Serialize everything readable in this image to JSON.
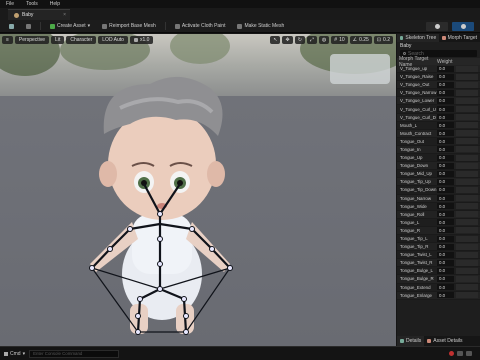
{
  "menu": {
    "items": [
      "File",
      "Tools",
      "Help"
    ]
  },
  "doc_tab": {
    "label": "Baby"
  },
  "toolbar": {
    "create_asset": "Create Asset",
    "reimport": "Reimport Base Mesh",
    "activate_cloth": "Activate Cloth Paint",
    "make_static": "Make Static Mesh"
  },
  "viewport": {
    "perspective": "Perspective",
    "lit": "Lit",
    "character": "Character",
    "lod": "LOD Auto",
    "speed": "x1.0",
    "stats": [
      "10",
      "0.25",
      "0.2"
    ]
  },
  "panel": {
    "tabs": [
      "Skeleton Tree",
      "Morph Target"
    ],
    "asset": "Baby",
    "search_placeholder": "Search",
    "col_name": "Morph Target Name",
    "col_weight": "Weight",
    "morphs": [
      {
        "name": "V_Tongue_up",
        "weight": "0.0"
      },
      {
        "name": "V_Tongue_Raise",
        "weight": "0.0"
      },
      {
        "name": "V_Tongue_Out",
        "weight": "0.0"
      },
      {
        "name": "V_Tongue_Narrow",
        "weight": "0.0"
      },
      {
        "name": "V_Tongue_Lower",
        "weight": "0.0"
      },
      {
        "name": "V_Tongue_Curl_U",
        "weight": "0.0"
      },
      {
        "name": "V_Tongue_Curl_D",
        "weight": "0.0"
      },
      {
        "name": "Mouth_L",
        "weight": "0.0"
      },
      {
        "name": "Mouth_Contract",
        "weight": "0.0"
      },
      {
        "name": "Tongue_Out",
        "weight": "0.0"
      },
      {
        "name": "Tongue_In",
        "weight": "0.0"
      },
      {
        "name": "Tongue_Up",
        "weight": "0.0"
      },
      {
        "name": "Tongue_Down",
        "weight": "0.0"
      },
      {
        "name": "Tongue_Mid_Up",
        "weight": "0.0"
      },
      {
        "name": "Tongue_Tip_Up",
        "weight": "0.0"
      },
      {
        "name": "Tongue_Tip_Down",
        "weight": "0.0"
      },
      {
        "name": "Tongue_Narrow",
        "weight": "0.0"
      },
      {
        "name": "Tongue_Wide",
        "weight": "0.0"
      },
      {
        "name": "Tongue_Roll",
        "weight": "0.0"
      },
      {
        "name": "Tongue_L",
        "weight": "0.0"
      },
      {
        "name": "Tongue_R",
        "weight": "0.0"
      },
      {
        "name": "Tongue_Tip_L",
        "weight": "0.0"
      },
      {
        "name": "Tongue_Tip_R",
        "weight": "0.0"
      },
      {
        "name": "Tongue_Twist_L",
        "weight": "0.0"
      },
      {
        "name": "Tongue_Twist_R",
        "weight": "0.0"
      },
      {
        "name": "Tongue_Bulge_L",
        "weight": "0.0"
      },
      {
        "name": "Tongue_Bulge_R",
        "weight": "0.0"
      },
      {
        "name": "Tongue_Extend",
        "weight": "0.0"
      },
      {
        "name": "Tongue_Enlarge",
        "weight": "0.0"
      }
    ],
    "footer_tabs": [
      "Details",
      "Asset Details"
    ]
  },
  "status": {
    "cmd": "Cmd",
    "cmd_placeholder": "Enter Console Command"
  },
  "colors": {
    "accent": "#1b4a7a",
    "record": "#c03030",
    "bone": "#10131a",
    "joint": "#e8e8ff"
  }
}
